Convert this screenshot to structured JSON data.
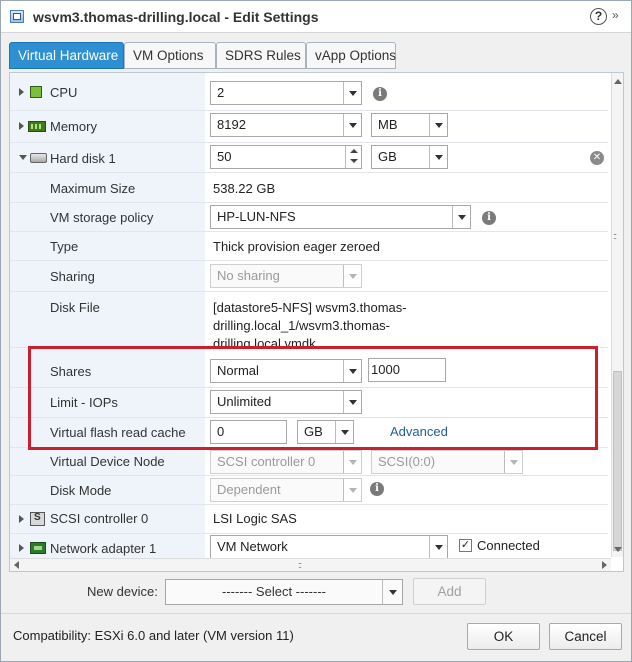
{
  "window": {
    "title": "wsvm3.thomas-drilling.local - Edit Settings",
    "help_glyph": "?",
    "expand_glyph": "»"
  },
  "tabs": [
    {
      "label": "Virtual Hardware",
      "active": true
    },
    {
      "label": "VM Options",
      "active": false
    },
    {
      "label": "SDRS Rules",
      "active": false
    },
    {
      "label": "vApp Options",
      "active": false
    }
  ],
  "hardware": {
    "cpu": {
      "label": "CPU",
      "value": "2"
    },
    "memory": {
      "label": "Memory",
      "value": "8192",
      "unit": "MB"
    },
    "hard_disk": {
      "label": "Hard disk 1",
      "value": "50",
      "unit": "GB",
      "max_size_label": "Maximum Size",
      "max_size_value": "538.22 GB",
      "storage_policy_label": "VM storage policy",
      "storage_policy_value": "HP-LUN-NFS",
      "type_label": "Type",
      "type_value": "Thick provision eager zeroed",
      "sharing_label": "Sharing",
      "sharing_value": "No sharing",
      "disk_file_label": "Disk File",
      "disk_file_lines": [
        "[datastore5-NFS] wsvm3.thomas-",
        "drilling.local_1/wsvm3.thomas-",
        "drilling.local.vmdk"
      ],
      "shares_label": "Shares",
      "shares_value": "Normal",
      "shares_number": "1000",
      "limit_label": "Limit - IOPs",
      "limit_value": "Unlimited",
      "flash_label": "Virtual flash read cache",
      "flash_value": "0",
      "flash_unit": "GB",
      "advanced_link": "Advanced",
      "vdn_label": "Virtual Device Node",
      "vdn_controller": "SCSI controller 0",
      "vdn_slot": "SCSI(0:0)",
      "disk_mode_label": "Disk Mode",
      "disk_mode_value": "Dependent"
    },
    "scsi": {
      "label": "SCSI controller 0",
      "value": "LSI Logic SAS"
    },
    "network": {
      "label": "Network adapter 1",
      "value": "VM Network",
      "connected_label": "Connected",
      "connected": true
    }
  },
  "footer": {
    "new_device_label": "New device:",
    "new_device_select": "------- Select -------",
    "add_label": "Add",
    "compatibility": "Compatibility: ESXi 6.0 and later (VM version 11)",
    "ok_label": "OK",
    "cancel_label": "Cancel"
  },
  "icons": {
    "cpu": "cpu-icon",
    "memory": "memory-icon",
    "hard_disk": "hard-disk-icon",
    "scsi": "scsi-controller-icon",
    "network": "network-adapter-icon",
    "info": "info-icon",
    "remove": "remove-icon"
  },
  "colors": {
    "active_tab": "#2e8fd3",
    "highlight_box": "#cc1f2d",
    "label_column": "#eef4fa",
    "link": "#1f5d9e"
  }
}
